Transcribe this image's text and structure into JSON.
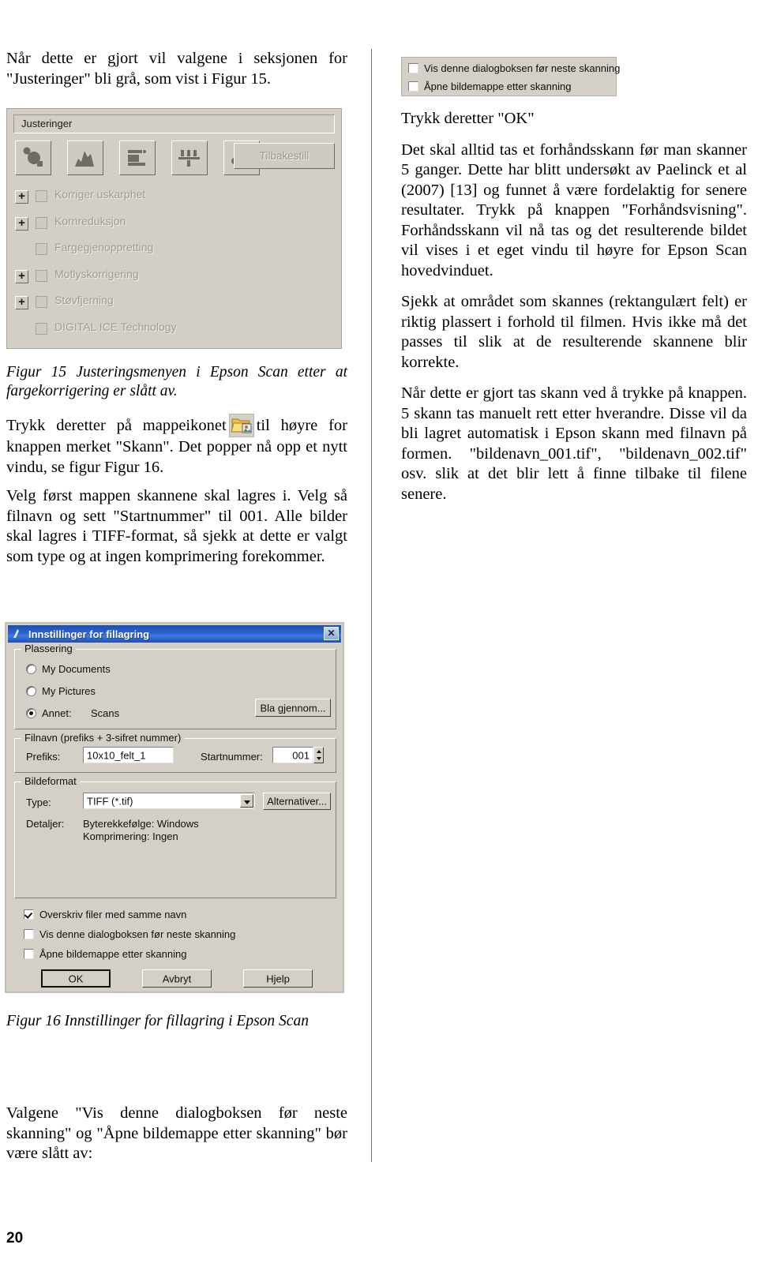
{
  "page": {
    "number": "20"
  },
  "left_column": {
    "intro_paragraph": "Når dette er gjort vil valgene i seksjonen for \"Justeringer\" bli grå, som vist i Figur 15.",
    "figure15": {
      "group_title": "Justeringer",
      "reset_button": "Tilbakestill",
      "toolbar_icons": [
        "color-adjustment-icon",
        "histogram-icon",
        "tone-correction-icon",
        "image-adjustment-icon",
        "color-palette-icon"
      ],
      "options": [
        {
          "label": "Korriger uskarphet",
          "has_expander": true,
          "checked": false,
          "disabled": true
        },
        {
          "label": "Kornreduksjon",
          "has_expander": true,
          "checked": false,
          "disabled": true
        },
        {
          "label": "Fargegjenoppretting",
          "has_expander": false,
          "checked": false,
          "disabled": true
        },
        {
          "label": "Motlyskorrigering",
          "has_expander": true,
          "checked": false,
          "disabled": true
        },
        {
          "label": "Støvfjerning",
          "has_expander": true,
          "checked": false,
          "disabled": true
        },
        {
          "label": "DIGITAL ICE Technology",
          "has_expander": false,
          "checked": false,
          "disabled": true
        }
      ]
    },
    "figure15_caption": "Figur 15 Justeringsmenyen i Epson Scan etter at fargekorrigering er slått av.",
    "paragraph_folder_pre": "Trykk deretter på mappeikonet",
    "paragraph_folder_post": "til høyre for knappen merket \"Skann\". Det popper nå opp et nytt vindu, se figur Figur 16.",
    "paragraph_filename": "Velg først mappen skannene skal lagres i. Velg så filnavn og sett \"Startnummer\" til 001. Alle bilder skal lagres i TIFF-format, så sjekk at dette er valgt som type og at ingen komprimering forekommer.",
    "figure16": {
      "title": "Innstillinger for fillagring",
      "close_label": "✕",
      "location_group": "Plassering",
      "location_options": [
        {
          "label": "My Documents",
          "selected": false
        },
        {
          "label": "My Pictures",
          "selected": false
        },
        {
          "label": "Annet:",
          "selected": true
        }
      ],
      "location_other_value": "Scans",
      "browse_button": "Bla gjennom...",
      "filename_group": "Filnavn (prefiks + 3-sifret nummer)",
      "prefix_label": "Prefiks:",
      "prefix_value": "10x10_felt_1",
      "startnumber_label": "Startnummer:",
      "startnumber_value": "001",
      "imageformat_group": "Bildeformat",
      "type_label": "Type:",
      "type_value": "TIFF (*.tif)",
      "options_button": "Alternativer...",
      "details_label": "Detaljer:",
      "details_line1": "Byterekkefølge: Windows",
      "details_line2": "Komprimering: Ingen",
      "checkboxes": [
        {
          "label": "Overskriv filer med samme navn",
          "checked": true
        },
        {
          "label": "Vis denne dialogboksen før neste skanning",
          "checked": false
        },
        {
          "label": "Åpne bildemappe etter skanning",
          "checked": false
        }
      ],
      "buttons": [
        "OK",
        "Avbryt",
        "Hjelp"
      ]
    },
    "figure16_caption": "Figur 16 Innstillinger for fillagring i Epson Scan",
    "closing_paragraph": "Valgene \"Vis denne dialogboksen før neste skanning\" og \"Åpne bildemappe etter skanning\" bør være slått av:"
  },
  "right_column": {
    "figure_checkboxes": [
      {
        "label": "Vis denne dialogboksen før neste skanning",
        "checked": false
      },
      {
        "label": "Åpne bildemappe etter skanning",
        "checked": false
      }
    ],
    "paragraph_ok": "Trykk deretter \"OK\"",
    "paragraph_prescan": "Det skal alltid tas et forhåndsskann før man skanner 5 ganger. Dette har blitt undersøkt av Paelinck et al (2007) [13] og funnet å være fordelaktig for senere resultater. Trykk på knappen \"Forhåndsvisning\". Forhåndsskann vil nå tas og det resulterende bildet vil vises i et eget vindu til høyre for Epson Scan hovedvinduet.",
    "paragraph_area": "Sjekk at området som skannes (rektangulært felt) er riktig plassert i forhold til filmen. Hvis ikke må det passes til slik at de resulterende skannene blir korrekte.",
    "paragraph_scan": " Når dette er gjort tas skann ved å trykke på knappen. 5 skann tas manuelt rett etter hverandre. Disse vil da bli lagret automatisk i Epson skann med filnavn på formen. \"bildenavn_001.tif\", \"bildenavn_002.tif\" osv. slik at det blir lett å finne tilbake til filene senere."
  },
  "colors": {
    "win_face": "#d4d0c8",
    "title_blue": "#1e4fb0",
    "disabled_text": "#a09b92"
  }
}
